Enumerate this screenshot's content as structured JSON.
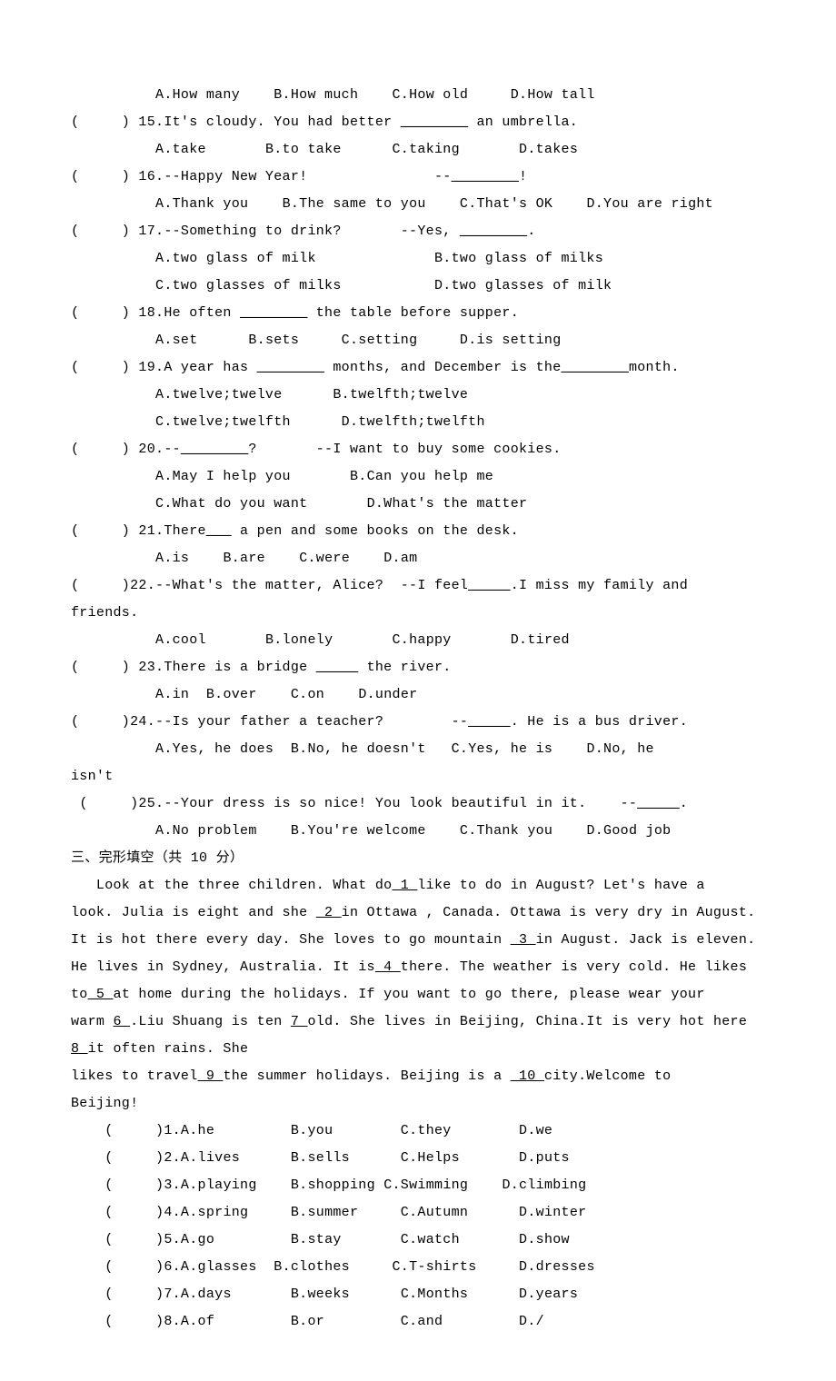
{
  "q14": {
    "indent": "          ",
    "a": "A.How many",
    "b": "B.How much",
    "c": "C.How old",
    "d": "D.How tall"
  },
  "q15": {
    "stem_pre": "(     ) 15.It's cloudy. You had better ",
    "blank": "________",
    "stem_post": " an umbrella.",
    "indent": "          ",
    "a": "A.take",
    "b": "B.to take",
    "c": "C.taking",
    "d": "D.takes"
  },
  "q16": {
    "stem_pre": "(     ) 16.--Happy New Year!               --",
    "blank": "________",
    "stem_post": "!",
    "indent": "          ",
    "a": "A.Thank you",
    "b": "B.The same to you",
    "c": "C.That's OK",
    "d": "D.You are right"
  },
  "q17": {
    "stem_pre": "(     ) 17.--Something to drink?       --Yes, ",
    "blank": "________",
    "stem_post": ".",
    "indent": "          ",
    "a": "A.two glass of milk",
    "b": "B.two glass of milks",
    "c": "C.two glasses of milks",
    "d": "D.two glasses of milk"
  },
  "q18": {
    "stem_pre": "(     ) 18.He often ",
    "blank": "________",
    "stem_post": " the table before supper.",
    "indent": "          ",
    "a": "A.set",
    "b": "B.sets",
    "c": "C.setting",
    "d": "D.is setting"
  },
  "q19": {
    "stem_pre": "(     ) 19.A year has ",
    "blank1": "________",
    "stem_mid": " months, and December is the",
    "blank2": "________",
    "stem_post": "month.",
    "indent": "          ",
    "a": "A.twelve;twelve",
    "b": "B.twelfth;twelve",
    "c": "C.twelve;twelfth",
    "d": "D.twelfth;twelfth"
  },
  "q20": {
    "stem_pre": "(     ) 20.--",
    "blank": "________",
    "stem_post": "?       --I want to buy some cookies.",
    "indent": "          ",
    "a": "A.May I help you",
    "b": "B.Can you help me",
    "c": "C.What do you want",
    "d": "D.What's the matter"
  },
  "q21": {
    "stem_pre": "(     ) 21.There",
    "blank": "___",
    "stem_post": " a pen and some books on the desk.",
    "indent": "          ",
    "a": "A.is",
    "b": "B.are",
    "c": "C.were",
    "d": "D.am"
  },
  "q22": {
    "stem_pre": "(     )22.--What's the matter, Alice?  --I feel",
    "blank": "_____",
    "stem_post": ".I miss my family and",
    "cont": "friends.",
    "indent": "          ",
    "a": "A.cool",
    "b": "B.lonely",
    "c": "C.happy",
    "d": "D.tired"
  },
  "q23": {
    "stem_pre": "(     ) 23.There is a bridge ",
    "blank": "_____",
    "stem_post": " the river.",
    "indent": "          ",
    "a": "A.in",
    "b": "B.over",
    "c": "C.on",
    "d": "D.under"
  },
  "q24": {
    "stem_pre": "(     )24.--Is your father a teacher?        --",
    "blank": "_____",
    "stem_post": ". He is a bus driver.",
    "indent": "          ",
    "a": "A.Yes, he does",
    "b": "B.No, he doesn't",
    "c": "C.Yes, he is",
    "d": "D.No, he",
    "cont": "isn't"
  },
  "q25": {
    "stem_pre": " (     )25.--Your dress is so nice! You look beautiful in it.    --",
    "blank": "_____",
    "stem_post": ".",
    "indent": "          ",
    "a": "A.No problem",
    "b": "B.You're welcome",
    "c": "C.Thank you",
    "d": "D.Good job"
  },
  "section3": "三、完形填空（共 10 分）",
  "cloze": {
    "p1a": "   Look at the three children. What do",
    "b1": " 1 ",
    "p1b": "like to do in August? Let's have a",
    "p2a": "look. Julia is eight and she ",
    "b2": " 2 ",
    "p2b": "in Ottawa , Canada. Ottawa is very dry in August.",
    "p3a": "It is hot there every day. She loves to go mountain ",
    "b3": " 3 ",
    "p3b": "in August. Jack is eleven.",
    "p4a": "He lives in Sydney, Australia. It is",
    "b4": " 4 ",
    "p4b": "there. The weather is very cold. He likes",
    "p5a": "to",
    "b5": " 5 ",
    "p5b": "at home during the holidays. If you want to go there, please wear your",
    "p6a": "warm ",
    "b6": "6 ",
    "p6b": ".Liu Shuang is ten ",
    "b7": "7 ",
    "p6c": "old. She lives in Beijing, China.It is very hot here",
    "b8": "8 ",
    "p7a": "it often rains. She",
    "p8a": "likes to travel",
    "b9": " 9 ",
    "p8b": "the summer holidays. Beijing is a ",
    "b10": " 10 ",
    "p8c": "city.Welcome to",
    "p9": "Beijing!"
  },
  "c1": {
    "pre": "    (     )1.A.he",
    "b": "B.you",
    "c": "C.they",
    "d": "D.we"
  },
  "c2": {
    "pre": "    (     )2.A.lives",
    "b": "B.sells",
    "c": "C.Helps",
    "d": "D.puts"
  },
  "c3": {
    "pre": "    (     )3.A.playing",
    "b": "B.shopping",
    "c": "C.Swimming",
    "d": "D.climbing"
  },
  "c4": {
    "pre": "    (     )4.A.spring",
    "b": "B.summer",
    "c": "C.Autumn",
    "d": "D.winter"
  },
  "c5": {
    "pre": "    (     )5.A.go",
    "b": "B.stay",
    "c": "C.watch",
    "d": "D.show"
  },
  "c6": {
    "pre": "    (     )6.A.glasses",
    "b": "B.clothes",
    "c": "C.T-shirts",
    "d": "D.dresses"
  },
  "c7": {
    "pre": "    (     )7.A.days",
    "b": "B.weeks",
    "c": "C.Months",
    "d": "D.years"
  },
  "c8": {
    "pre": "    (     )8.A.of",
    "b": "B.or",
    "c": "C.and",
    "d": "D./"
  }
}
